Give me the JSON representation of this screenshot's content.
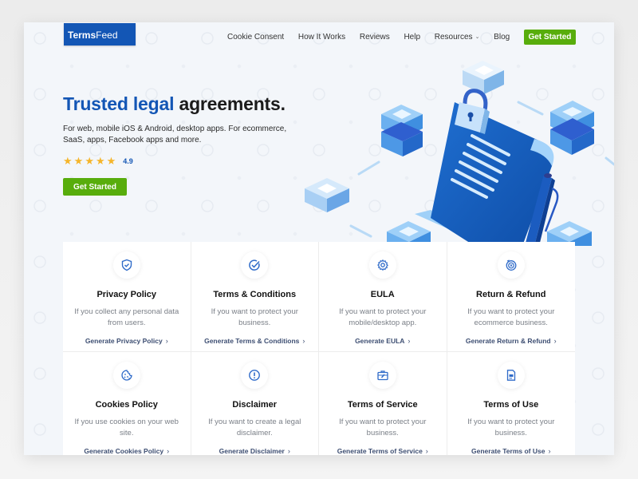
{
  "brand": {
    "name_bold": "Terms",
    "name_regular": "Feed",
    "color": "#1356b5"
  },
  "nav": {
    "items": [
      "Cookie Consent",
      "How It Works",
      "Reviews",
      "Help",
      "Resources",
      "Blog"
    ],
    "cta": "Get Started"
  },
  "hero": {
    "title_accent": "Trusted legal",
    "title_rest": " agreements.",
    "subtitle": "For web, mobile iOS & Android, desktop apps. For ecommerce, SaaS, apps, Facebook apps and more.",
    "rating": {
      "stars": 5,
      "max": 5,
      "value": "4.9"
    },
    "cta": "Get Started"
  },
  "colors": {
    "accent": "#1356b5",
    "cta_green": "#58ad0c",
    "star": "#f5b52a",
    "link": "#3d4e72"
  },
  "cards": [
    {
      "icon": "shield-check-icon",
      "title": "Privacy Policy",
      "desc": "If you collect any personal data from users.",
      "link": "Generate Privacy Policy"
    },
    {
      "icon": "check-circle-icon",
      "title": "Terms & Conditions",
      "desc": "If you want to protect your business.",
      "link": "Generate Terms & Conditions"
    },
    {
      "icon": "gear-icon",
      "title": "EULA",
      "desc": "If you want to protect your mobile/desktop app.",
      "link": "Generate EULA"
    },
    {
      "icon": "refund-icon",
      "title": "Return & Refund",
      "desc": "If you want to protect your ecommerce business.",
      "link": "Generate Return & Refund"
    },
    {
      "icon": "cookie-icon",
      "title": "Cookies Policy",
      "desc": "If you use cookies on your web site.",
      "link": "Generate Cookies Policy"
    },
    {
      "icon": "alert-circle-icon",
      "title": "Disclaimer",
      "desc": "If you want to create a legal disclaimer.",
      "link": "Generate Disclaimer"
    },
    {
      "icon": "briefcase-icon",
      "title": "Terms of Service",
      "desc": "If you want to protect your business.",
      "link": "Generate Terms of Service"
    },
    {
      "icon": "document-icon",
      "title": "Terms of Use",
      "desc": "If you want to protect your business.",
      "link": "Generate Terms of Use"
    }
  ]
}
